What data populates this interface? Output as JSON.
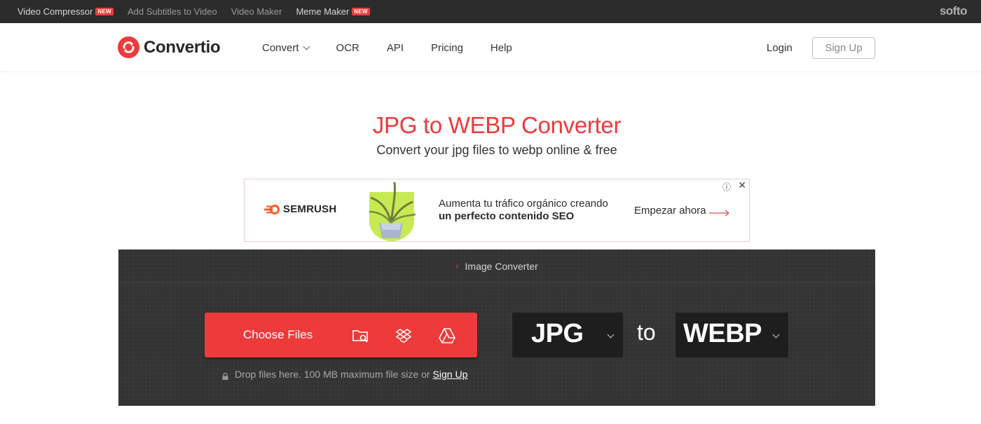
{
  "topbar": {
    "links": [
      {
        "label": "Video Compressor",
        "badge": "NEW"
      },
      {
        "label": "Add Subtitles to Video",
        "badge": ""
      },
      {
        "label": "Video Maker",
        "badge": ""
      },
      {
        "label": "Meme Maker",
        "badge": "NEW"
      }
    ],
    "brand": "softo"
  },
  "nav": {
    "logo": "Convertio",
    "menu": [
      "Convert",
      "OCR",
      "API",
      "Pricing",
      "Help"
    ],
    "login": "Login",
    "signup": "Sign Up"
  },
  "hero": {
    "title": "JPG to WEBP Converter",
    "subtitle": "Convert your jpg files to webp online & free"
  },
  "ad": {
    "brand": "SEMRUSH",
    "line1": "Aumenta tu tráfico orgánico creando",
    "line2": "un perfecto contenido SEO",
    "cta": "Empezar ahora",
    "info_icon": "ⓘ",
    "close_icon": "✕"
  },
  "converter": {
    "breadcrumb": "Image Converter",
    "choose_label": "Choose Files",
    "hint": "Drop files here. 100 MB maximum file size or",
    "hint_link": "Sign Up",
    "from_format": "JPG",
    "to_word": "to",
    "to_format": "WEBP"
  },
  "colors": {
    "accent": "#ee3a3a",
    "topbar": "#2c2c2c",
    "panel": "#343434",
    "format_box": "#1e1e1e"
  },
  "icons": [
    "folder-search-icon",
    "dropbox-icon",
    "google-drive-icon",
    "lock-icon",
    "chevron-down-icon",
    "chevron-left-icon"
  ]
}
